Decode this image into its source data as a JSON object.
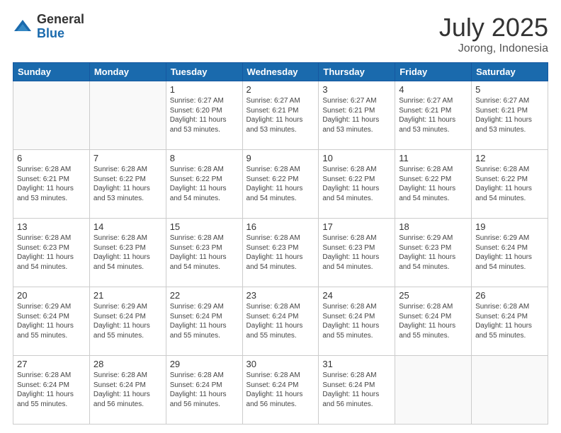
{
  "logo": {
    "general": "General",
    "blue": "Blue"
  },
  "title": {
    "month": "July 2025",
    "location": "Jorong, Indonesia"
  },
  "weekdays": [
    "Sunday",
    "Monday",
    "Tuesday",
    "Wednesday",
    "Thursday",
    "Friday",
    "Saturday"
  ],
  "weeks": [
    [
      {
        "day": "",
        "info": ""
      },
      {
        "day": "",
        "info": ""
      },
      {
        "day": "1",
        "info": "Sunrise: 6:27 AM\nSunset: 6:20 PM\nDaylight: 11 hours and 53 minutes."
      },
      {
        "day": "2",
        "info": "Sunrise: 6:27 AM\nSunset: 6:21 PM\nDaylight: 11 hours and 53 minutes."
      },
      {
        "day": "3",
        "info": "Sunrise: 6:27 AM\nSunset: 6:21 PM\nDaylight: 11 hours and 53 minutes."
      },
      {
        "day": "4",
        "info": "Sunrise: 6:27 AM\nSunset: 6:21 PM\nDaylight: 11 hours and 53 minutes."
      },
      {
        "day": "5",
        "info": "Sunrise: 6:27 AM\nSunset: 6:21 PM\nDaylight: 11 hours and 53 minutes."
      }
    ],
    [
      {
        "day": "6",
        "info": "Sunrise: 6:28 AM\nSunset: 6:21 PM\nDaylight: 11 hours and 53 minutes."
      },
      {
        "day": "7",
        "info": "Sunrise: 6:28 AM\nSunset: 6:22 PM\nDaylight: 11 hours and 53 minutes."
      },
      {
        "day": "8",
        "info": "Sunrise: 6:28 AM\nSunset: 6:22 PM\nDaylight: 11 hours and 54 minutes."
      },
      {
        "day": "9",
        "info": "Sunrise: 6:28 AM\nSunset: 6:22 PM\nDaylight: 11 hours and 54 minutes."
      },
      {
        "day": "10",
        "info": "Sunrise: 6:28 AM\nSunset: 6:22 PM\nDaylight: 11 hours and 54 minutes."
      },
      {
        "day": "11",
        "info": "Sunrise: 6:28 AM\nSunset: 6:22 PM\nDaylight: 11 hours and 54 minutes."
      },
      {
        "day": "12",
        "info": "Sunrise: 6:28 AM\nSunset: 6:22 PM\nDaylight: 11 hours and 54 minutes."
      }
    ],
    [
      {
        "day": "13",
        "info": "Sunrise: 6:28 AM\nSunset: 6:23 PM\nDaylight: 11 hours and 54 minutes."
      },
      {
        "day": "14",
        "info": "Sunrise: 6:28 AM\nSunset: 6:23 PM\nDaylight: 11 hours and 54 minutes."
      },
      {
        "day": "15",
        "info": "Sunrise: 6:28 AM\nSunset: 6:23 PM\nDaylight: 11 hours and 54 minutes."
      },
      {
        "day": "16",
        "info": "Sunrise: 6:28 AM\nSunset: 6:23 PM\nDaylight: 11 hours and 54 minutes."
      },
      {
        "day": "17",
        "info": "Sunrise: 6:28 AM\nSunset: 6:23 PM\nDaylight: 11 hours and 54 minutes."
      },
      {
        "day": "18",
        "info": "Sunrise: 6:29 AM\nSunset: 6:23 PM\nDaylight: 11 hours and 54 minutes."
      },
      {
        "day": "19",
        "info": "Sunrise: 6:29 AM\nSunset: 6:24 PM\nDaylight: 11 hours and 54 minutes."
      }
    ],
    [
      {
        "day": "20",
        "info": "Sunrise: 6:29 AM\nSunset: 6:24 PM\nDaylight: 11 hours and 55 minutes."
      },
      {
        "day": "21",
        "info": "Sunrise: 6:29 AM\nSunset: 6:24 PM\nDaylight: 11 hours and 55 minutes."
      },
      {
        "day": "22",
        "info": "Sunrise: 6:29 AM\nSunset: 6:24 PM\nDaylight: 11 hours and 55 minutes."
      },
      {
        "day": "23",
        "info": "Sunrise: 6:28 AM\nSunset: 6:24 PM\nDaylight: 11 hours and 55 minutes."
      },
      {
        "day": "24",
        "info": "Sunrise: 6:28 AM\nSunset: 6:24 PM\nDaylight: 11 hours and 55 minutes."
      },
      {
        "day": "25",
        "info": "Sunrise: 6:28 AM\nSunset: 6:24 PM\nDaylight: 11 hours and 55 minutes."
      },
      {
        "day": "26",
        "info": "Sunrise: 6:28 AM\nSunset: 6:24 PM\nDaylight: 11 hours and 55 minutes."
      }
    ],
    [
      {
        "day": "27",
        "info": "Sunrise: 6:28 AM\nSunset: 6:24 PM\nDaylight: 11 hours and 55 minutes."
      },
      {
        "day": "28",
        "info": "Sunrise: 6:28 AM\nSunset: 6:24 PM\nDaylight: 11 hours and 56 minutes."
      },
      {
        "day": "29",
        "info": "Sunrise: 6:28 AM\nSunset: 6:24 PM\nDaylight: 11 hours and 56 minutes."
      },
      {
        "day": "30",
        "info": "Sunrise: 6:28 AM\nSunset: 6:24 PM\nDaylight: 11 hours and 56 minutes."
      },
      {
        "day": "31",
        "info": "Sunrise: 6:28 AM\nSunset: 6:24 PM\nDaylight: 11 hours and 56 minutes."
      },
      {
        "day": "",
        "info": ""
      },
      {
        "day": "",
        "info": ""
      }
    ]
  ]
}
